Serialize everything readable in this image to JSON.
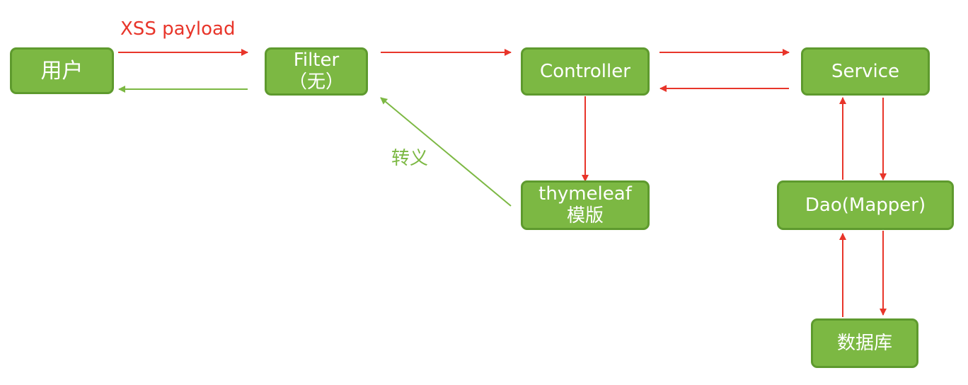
{
  "nodes": {
    "user": "用户",
    "filter_line1": "Filter",
    "filter_line2": "（无）",
    "controller": "Controller",
    "service": "Service",
    "thymeleaf_line1": "thymeleaf",
    "thymeleaf_line2": "模版",
    "dao": "Dao(Mapper)",
    "database": "数据库"
  },
  "labels": {
    "xss_payload": "XSS payload",
    "escape": "转义"
  },
  "colors": {
    "node_fill": "#7cb843",
    "node_border": "#5e9a2e",
    "request_arrow": "#e8352a",
    "escape_arrow": "#7cb843"
  }
}
